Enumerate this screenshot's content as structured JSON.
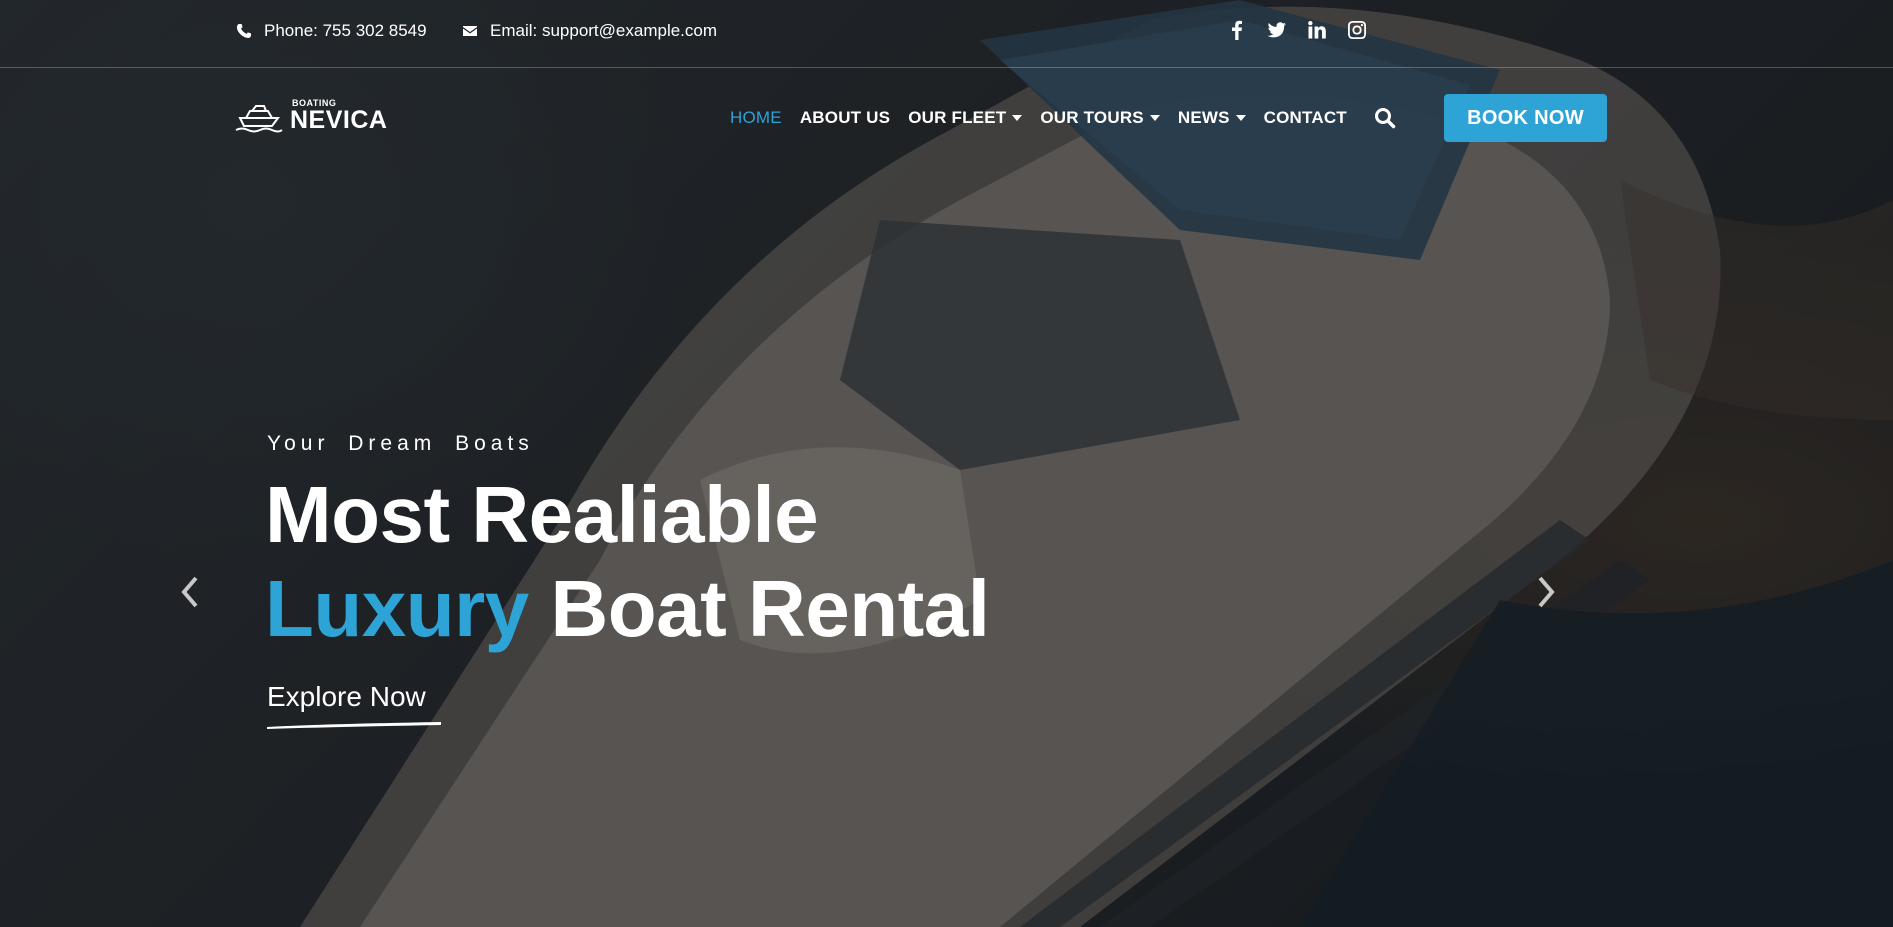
{
  "topbar": {
    "phone": "Phone: 755 302 8549",
    "email": "Email: support@example.com",
    "social": [
      "facebook-icon",
      "twitter-icon",
      "linkedin-icon",
      "instagram-icon"
    ]
  },
  "logo": {
    "small": "BOATING",
    "big": "NEVICA"
  },
  "nav": {
    "items": [
      {
        "label": "HOME",
        "active": true,
        "dropdown": false
      },
      {
        "label": "ABOUT US",
        "active": false,
        "dropdown": false
      },
      {
        "label": "OUR FLEET",
        "active": false,
        "dropdown": true
      },
      {
        "label": "OUR TOURS",
        "active": false,
        "dropdown": true
      },
      {
        "label": "NEWS",
        "active": false,
        "dropdown": true
      },
      {
        "label": "CONTACT",
        "active": false,
        "dropdown": false
      }
    ],
    "search_icon": "search-icon",
    "cta": "BOOK NOW"
  },
  "hero": {
    "eyebrow": "Your Dream Boats",
    "line1": "Most Realiable",
    "accent": "Luxury",
    "line2_rest": " Boat Rental",
    "link": "Explore Now",
    "prev_icon": "chevron-left-icon",
    "next_icon": "chevron-right-icon"
  },
  "colors": {
    "accent": "#2ea3d5",
    "text": "#ffffff"
  }
}
